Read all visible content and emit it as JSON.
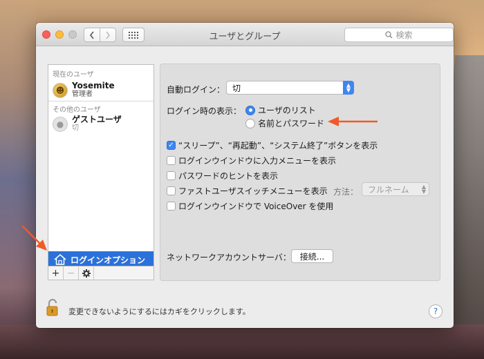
{
  "window": {
    "title": "ユーザとグループ",
    "search_placeholder": "検索"
  },
  "sidebar": {
    "current_users_label": "現在のユーザ",
    "other_users_label": "その他のユーザ",
    "users": [
      {
        "name": "Yosemite",
        "role": "管理者"
      },
      {
        "name": "ゲストユーザ",
        "role": "切"
      }
    ],
    "login_options_label": "ログインオプション",
    "add_label": "+",
    "remove_label": "−"
  },
  "pane": {
    "auto_login_label": "自動ログイン：",
    "auto_login_value": "切",
    "display_label": "ログイン時の表示：",
    "display_options": [
      "ユーザのリスト",
      "名前とパスワード"
    ],
    "selected_display": "ユーザのリスト",
    "checkboxes": [
      {
        "label": "“スリープ”、“再起動”、“システム終了”ボタンを表示",
        "checked": true
      },
      {
        "label": "ログインウインドウに入力メニューを表示",
        "checked": false
      },
      {
        "label": "パスワードのヒントを表示",
        "checked": false
      },
      {
        "label": "ファストユーザスイッチメニューを表示",
        "checked": false
      },
      {
        "label": "ログインウインドウで VoiceOver を使用",
        "checked": false
      }
    ],
    "method_label": "方法：",
    "method_value": "フルネーム",
    "network_label": "ネットワークアカウントサーバ：",
    "connect_button": "接続..."
  },
  "footer": {
    "lock_text": "変更できないようにするにはカギをクリックします。",
    "help_label": "?"
  },
  "colors": {
    "accent": "#3f86ef",
    "selection": "#2c71d9",
    "annotation_arrow": "#f05a28"
  }
}
